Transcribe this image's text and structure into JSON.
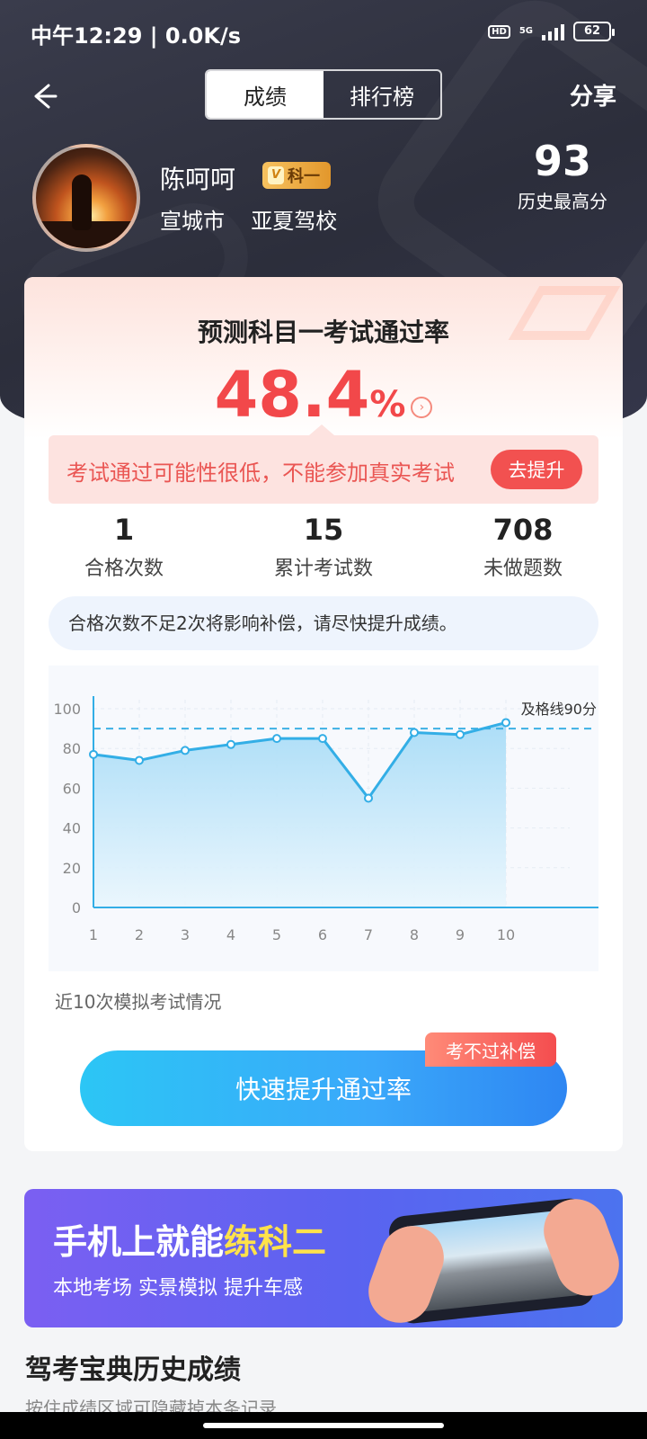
{
  "status_bar": {
    "time": "中午12:29 | 0.0K/s",
    "hd": "HD",
    "network": "5G",
    "battery": "62"
  },
  "nav": {
    "tabs": [
      "成绩",
      "排行榜"
    ],
    "active_tab": 0,
    "share": "分享"
  },
  "profile": {
    "name": "陈呵呵",
    "badge": "科一",
    "badge_v": "V",
    "city": "宣城市",
    "school": "亚夏驾校",
    "best_score": "93",
    "best_score_label": "历史最高分"
  },
  "prediction": {
    "title": "预测科目一考试通过率",
    "value": "48.4",
    "unit": "%",
    "warning": "考试通过可能性很低，不能参加真实考试",
    "improve_button": "去提升"
  },
  "stats": [
    {
      "value": "1",
      "label": "合格次数"
    },
    {
      "value": "15",
      "label": "累计考试数"
    },
    {
      "value": "708",
      "label": "未做题数"
    }
  ],
  "notice": "合格次数不足2次将影响补偿，请尽快提升成绩。",
  "chart_data": {
    "type": "area",
    "x": [
      1,
      2,
      3,
      4,
      5,
      6,
      7,
      8,
      9,
      10
    ],
    "y": [
      77,
      74,
      79,
      82,
      85,
      85,
      55,
      88,
      87,
      93
    ],
    "yticks": [
      0,
      20,
      40,
      60,
      80,
      100
    ],
    "ylim": [
      0,
      100
    ],
    "xlim": [
      1,
      11
    ],
    "pass_line": {
      "value": 90,
      "label": "及格线90分"
    },
    "colors": {
      "line": "#33aee6",
      "area_top": "#a8dcf7",
      "area_bottom": "#e9f6fd",
      "pass_line": "#3cb0e4"
    }
  },
  "chart_caption": "近10次模拟考试情况",
  "cta": {
    "label": "快速提升通过率",
    "tag": "考不过补偿"
  },
  "banner": {
    "title_part1": "手机上就能",
    "title_highlight": "练科二",
    "subtitle": "本地考场 实景模拟 提升车感"
  },
  "history": {
    "title": "驾考宝典历史成绩",
    "subtitle": "按住成绩区域可隐藏掉本条记录"
  }
}
